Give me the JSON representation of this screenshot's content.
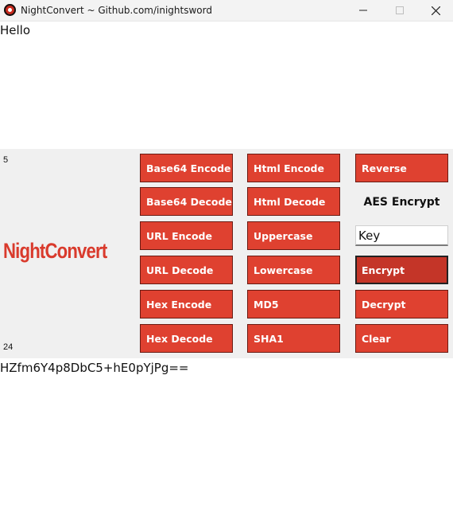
{
  "window": {
    "title": "NightConvert ~ Github.com/inightsword",
    "controls": {
      "minimize_icon": "minimize-icon",
      "maximize_icon": "maximize-icon",
      "close_icon": "close-icon"
    }
  },
  "input": {
    "value": "Hello"
  },
  "counts": {
    "top": "5",
    "bottom": "24"
  },
  "logo": {
    "text": "NightConvert",
    "color": "#d93a2c"
  },
  "buttons": {
    "col1": [
      "Base64 Encode",
      "Base64 Decode",
      "URL Encode",
      "URL Decode",
      "Hex Encode",
      "Hex Decode"
    ],
    "col2": [
      "Html Encode",
      "Html Decode",
      "Uppercase",
      "Lowercase",
      "MD5",
      "SHA1"
    ],
    "col3": {
      "reverse": "Reverse",
      "encrypt": "Encrypt",
      "decrypt": "Decrypt",
      "clear": "Clear"
    }
  },
  "aes": {
    "label": "AES Encrypt",
    "key_value": "Key"
  },
  "output": {
    "value": "HZfm6Y4p8DbC5+hE0pYjPg=="
  },
  "colors": {
    "button_bg": "#df4130",
    "panel_bg": "#f0f0f0"
  }
}
